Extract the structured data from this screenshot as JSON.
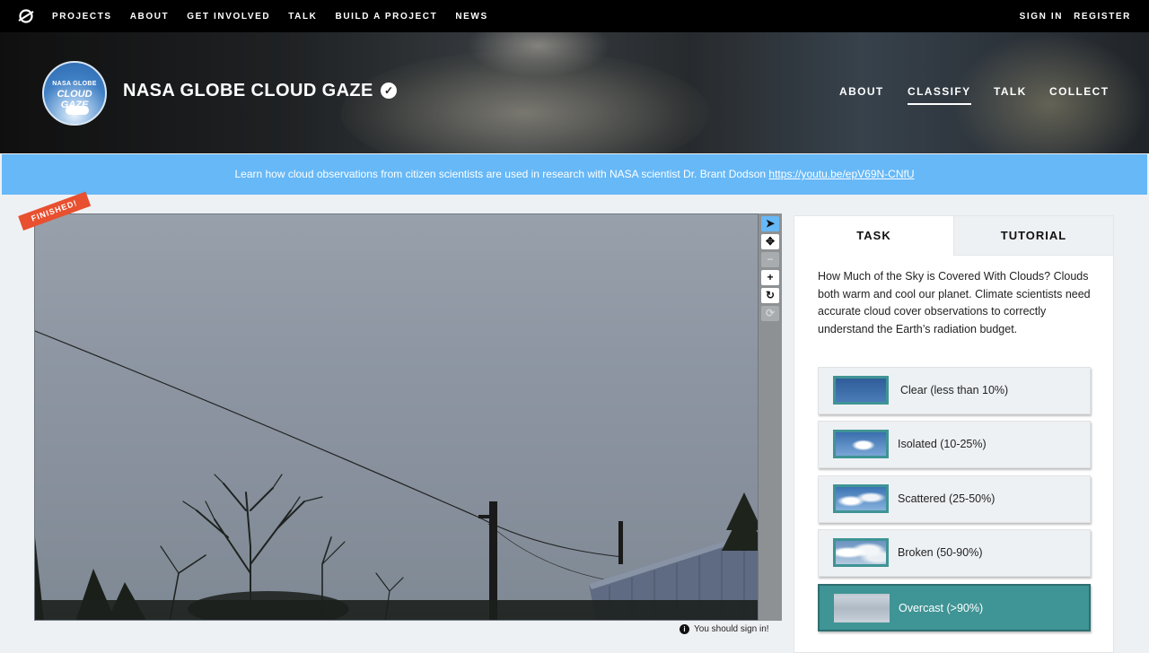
{
  "topnav": {
    "links": [
      "PROJECTS",
      "ABOUT",
      "GET INVOLVED",
      "TALK",
      "BUILD A PROJECT",
      "NEWS"
    ],
    "sign_in": "SIGN IN",
    "register": "REGISTER"
  },
  "project": {
    "avatar_line1": "NASA GLOBE",
    "avatar_line2": "CLOUD GAZE",
    "title": "NASA GLOBE CLOUD GAZE",
    "nav": [
      "ABOUT",
      "CLASSIFY",
      "TALK",
      "COLLECT"
    ]
  },
  "announcement": {
    "text": "Learn how cloud observations from citizen scientists are used in research with NASA scientist Dr. Brant Dodson ",
    "link": "https://youtu.be/epV69N-CNfU"
  },
  "viewer": {
    "finished_badge": "FINISHED!",
    "toolbar_glyphs": [
      "➤",
      "✥",
      "−",
      "+",
      "↻",
      "⟳"
    ],
    "signin_note": "You should sign in!"
  },
  "task": {
    "tabs": [
      "TASK",
      "TUTORIAL"
    ],
    "question": "How Much of the Sky is Covered With Clouds? Clouds both warm and cool our planet. Climate scientists need accurate cloud cover observations to correctly understand the Earth’s radiation budget.",
    "answers": [
      {
        "label": "Clear (less than 10%)"
      },
      {
        "label": "Isolated (10-25%)"
      },
      {
        "label": "Scattered (25-50%)"
      },
      {
        "label": "Broken (50-90%)"
      },
      {
        "label": "Overcast (>90%)"
      }
    ]
  },
  "colors": {
    "accent": "#66b8f7",
    "selected": "#3f9495",
    "badge": "#e8502f"
  }
}
